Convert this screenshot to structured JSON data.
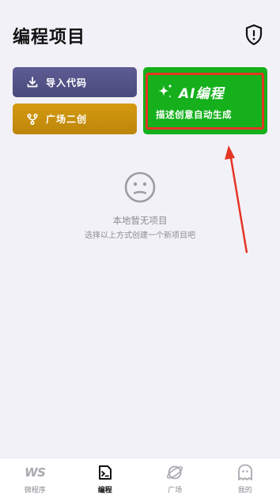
{
  "header": {
    "title": "编程项目",
    "icon": "shield-alert-icon"
  },
  "actions": {
    "import_label": "导入代码",
    "square_label": "广场二创",
    "ai_title": "AI编程",
    "ai_subtitle": "描述创意自动生成"
  },
  "empty_state": {
    "icon": "sad-face-icon",
    "title": "本地暂无项目",
    "hint": "选择以上方式创建一个新项目吧"
  },
  "tabbar": {
    "items": [
      {
        "label": "微程序",
        "icon": "ws-logo",
        "glyph": "WS",
        "active": false
      },
      {
        "label": "编程",
        "icon": "code-file-icon",
        "active": true
      },
      {
        "label": "广场",
        "icon": "planet-icon",
        "active": false
      },
      {
        "label": "我的",
        "icon": "ghost-avatar-icon",
        "active": false
      }
    ]
  },
  "colors": {
    "import_button": "#5d5c93",
    "square_button": "#d49a0f",
    "ai_card": "#15b01c",
    "highlight": "#e53524",
    "background": "#f3f1f8"
  }
}
